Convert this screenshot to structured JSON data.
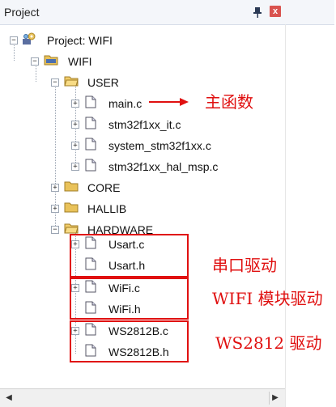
{
  "panel": {
    "title": "Project"
  },
  "tree": {
    "project": "Project: WIFI",
    "target": "WIFI",
    "groups": {
      "user": "USER",
      "core": "CORE",
      "hallib": "HALLIB",
      "hardware": "HARDWARE"
    },
    "user_files": [
      "main.c",
      "stm32f1xx_it.c",
      "system_stm32f1xx.c",
      "stm32f1xx_hal_msp.c"
    ],
    "hardware_files": [
      "Usart.c",
      "Usart.h",
      "WiFi.c",
      "WiFi.h",
      "WS2812B.c",
      "WS2812B.h"
    ]
  },
  "annotations": {
    "main_label": "主函数",
    "usart_label": "串口驱动",
    "wifi_label": "WIFI 模块驱动",
    "ws2812_label": "WS2812 驱动"
  },
  "colors": {
    "annotation": "#e01010",
    "folder": "#e9c25a",
    "header_bg": "#f4f6fa"
  },
  "icons": {
    "project": "project-gear-icon",
    "target": "target-folder-icon",
    "folder": "folder-icon",
    "file": "file-icon",
    "pin": "pin-icon",
    "close": "close-icon"
  }
}
